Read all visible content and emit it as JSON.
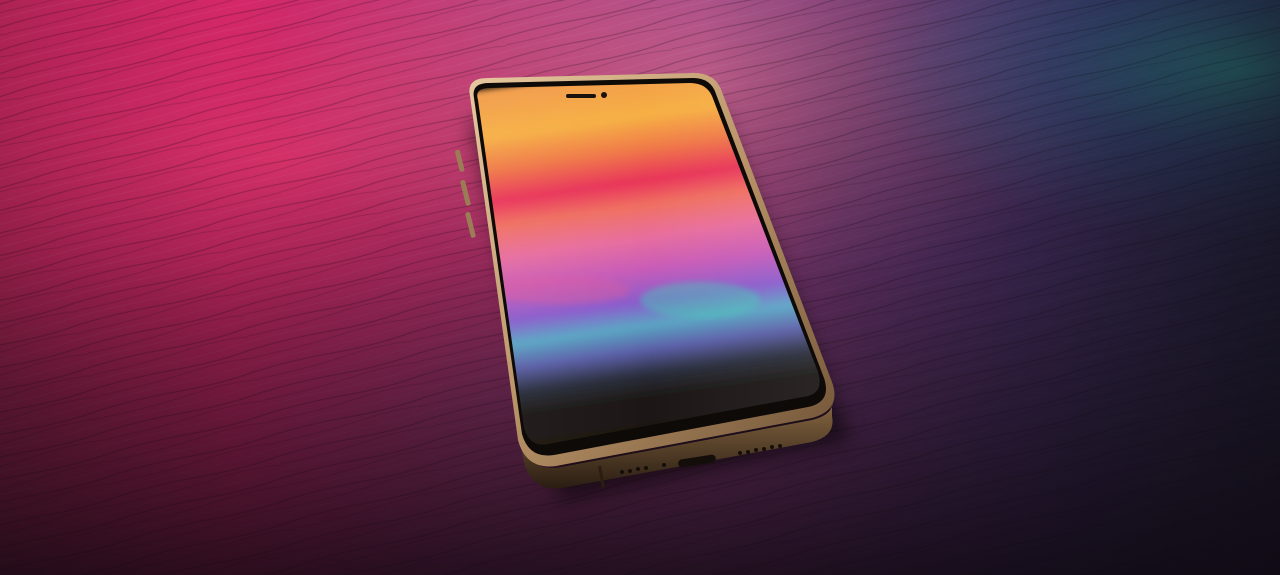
{
  "photo": {
    "subject": "smartphone-on-wooden-table",
    "colors": {
      "table_magenta": "#e8276a",
      "table_pink": "#c44a8a",
      "table_violet": "#7a4c9a",
      "table_blue": "#3a6fb0",
      "table_teal": "#2fb3b8",
      "table_dark": "#1c1218",
      "phone_frame_gold": "#c9a774",
      "phone_frame_dark": "#3b2a1c",
      "screen_orange": "#f3a044",
      "screen_red": "#e8325a",
      "screen_pink": "#e06b9b",
      "screen_violet": "#8b5bc7",
      "screen_teal": "#3fbfae",
      "screen_dark": "#1b1510"
    }
  }
}
